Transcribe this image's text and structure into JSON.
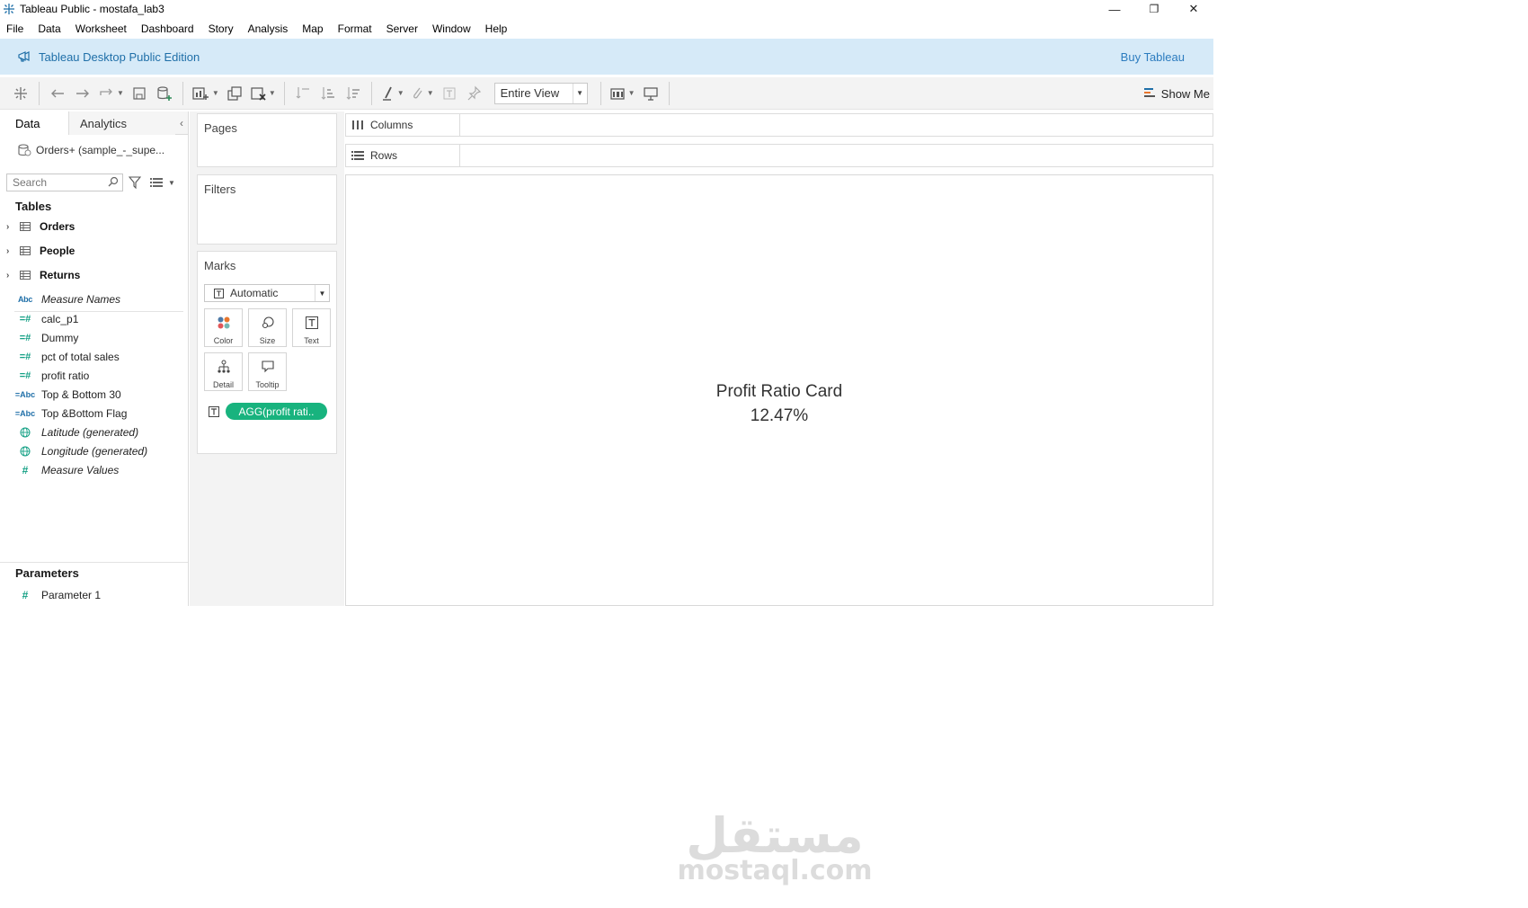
{
  "window": {
    "title": "Tableau Public - mostafa_lab3",
    "controls": {
      "minimize": "—",
      "restore": "❐",
      "close": "✕"
    }
  },
  "menu": [
    "File",
    "Data",
    "Worksheet",
    "Dashboard",
    "Story",
    "Analysis",
    "Map",
    "Format",
    "Server",
    "Window",
    "Help"
  ],
  "banner": {
    "edition": "Tableau Desktop Public Edition",
    "buy": "Buy Tableau",
    "background_color": "#d6eaf8"
  },
  "toolbar": {
    "fit_value": "Entire View",
    "show_me": "Show Me"
  },
  "data_pane": {
    "tab_data": "Data",
    "tab_analytics": "Analytics",
    "datasource": "Orders+ (sample_-_supe...",
    "search_placeholder": "Search",
    "tables_heading": "Tables",
    "tables": [
      "Orders",
      "People",
      "Returns"
    ],
    "fields": [
      {
        "icon": "Abc",
        "type": "abc",
        "label": "Measure Names",
        "italic": true
      },
      {
        "icon": "=#",
        "type": "calchash",
        "label": "calc_p1",
        "italic": false
      },
      {
        "icon": "=#",
        "type": "calchash",
        "label": "Dummy",
        "italic": false
      },
      {
        "icon": "=#",
        "type": "calchash",
        "label": "pct of total sales",
        "italic": false
      },
      {
        "icon": "=#",
        "type": "calchash",
        "label": "profit ratio",
        "italic": false
      },
      {
        "icon": "=Abc",
        "type": "calcabc",
        "label": "Top & Bottom 30",
        "italic": false
      },
      {
        "icon": "=Abc",
        "type": "calcabc",
        "label": "Top &Bottom Flag",
        "italic": false
      },
      {
        "icon": "globe",
        "type": "globe",
        "label": "Latitude (generated)",
        "italic": true
      },
      {
        "icon": "globe",
        "type": "globe",
        "label": "Longitude (generated)",
        "italic": true
      },
      {
        "icon": "#",
        "type": "hash",
        "label": "Measure Values",
        "italic": true
      }
    ],
    "parameters_heading": "Parameters",
    "parameters": [
      {
        "icon": "#",
        "label": "Parameter 1"
      }
    ]
  },
  "cards": {
    "pages": "Pages",
    "filters": "Filters",
    "marks": "Marks",
    "mark_type": "Automatic",
    "mark_buttons": [
      "Color",
      "Size",
      "Text",
      "Detail",
      "Tooltip"
    ],
    "pill": "AGG(profit rati..",
    "pill_color": "#18b37e"
  },
  "shelves": {
    "columns": "Columns",
    "rows": "Rows"
  },
  "view": {
    "title": "Profit Ratio Card",
    "value": "12.47%"
  },
  "watermark": {
    "arabic": "مستقل",
    "latin": "mostaql.com"
  }
}
